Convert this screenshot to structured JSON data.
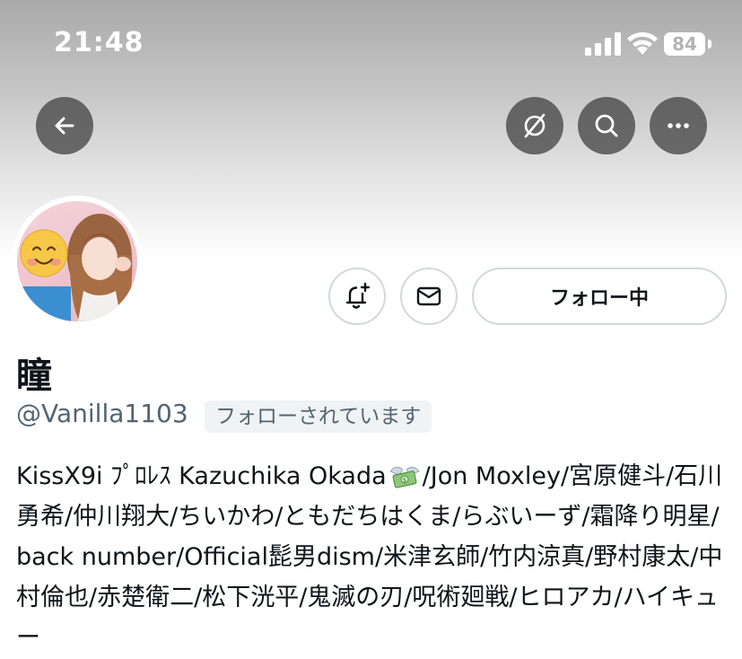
{
  "status_bar": {
    "time": "21:48",
    "battery": "84"
  },
  "colors": {
    "text_primary": "#0f1419",
    "text_secondary": "#536471",
    "border": "#cfd9de",
    "overlay_button": "#464646"
  },
  "header": {
    "back_icon": "arrow-left-icon",
    "grok_icon": "grok-icon",
    "search_icon": "search-icon",
    "more_icon": "more-horizontal-icon"
  },
  "actions": {
    "notify_icon": "bell-plus-icon",
    "message_icon": "envelope-icon",
    "follow_label": "フォロー中"
  },
  "profile": {
    "display_name": "瞳",
    "handle": "@Vanilla1103",
    "follows_you": "フォローされています",
    "bio_part1": "KissX9i ﾌﾟﾛﾚｽ Kazuchika Okada",
    "bio_emoji": "money-with-wings-emoji",
    "bio_part2": "/Jon Moxley/宮原健斗/石川勇希/仲川翔大/ちいかわ/ともだちはくま/らぶいーず/霜降り明星/back number/Official髭男dism/米津玄師/竹内涼真/野村康太/中村倫也/赤楚衛二/松下洸平/鬼滅の刃/呪術廻戦/ヒロアカ/ハイキュー"
  }
}
